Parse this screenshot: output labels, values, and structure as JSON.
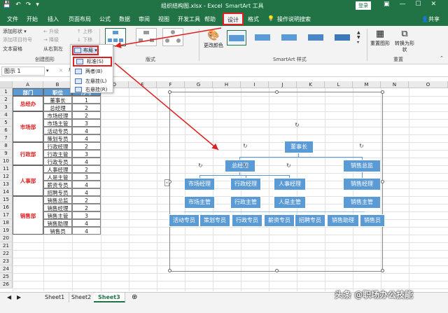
{
  "titlebar": {
    "file_title": "组织结构图.xlsx - Excel",
    "context_title": "SmartArt 工具",
    "login": "登录",
    "min": "—",
    "restore": "☐",
    "close": "✕"
  },
  "tabs": [
    "文件",
    "开始",
    "插入",
    "页面布局",
    "公式",
    "数据",
    "审阅",
    "视图",
    "开发工具",
    "帮助"
  ],
  "tab_design": "设计",
  "tab_format": "格式",
  "tell_me": "操作说明搜索",
  "share": "共享",
  "ribbon": {
    "add_shape": "添加形状 ▾",
    "add_bullet": "添加项目符号",
    "text_pane": "文本窗格",
    "promote": "← 升级",
    "demote": "→ 降级",
    "rtl": "从右到左",
    "move_up": "↑ 上移",
    "move_down": "↓ 下移",
    "layout_btn": "布局 ▾",
    "group_create": "创建图形",
    "group_layouts": "版式",
    "change_colors": "更改颜色",
    "group_styles": "SmartArt 样式",
    "reset": "重置图形",
    "convert": "转换为形状",
    "group_reset": "重置"
  },
  "layout_menu": {
    "standard": "标准(S)",
    "both": "两者(B)",
    "left_hanging": "左悬挂(L)",
    "right_hanging": "右悬挂(R)"
  },
  "formula_bar": {
    "name_box": "图示 1",
    "fx": "fx",
    "cancel": "✕"
  },
  "columns": [
    "A",
    "B",
    "C",
    "D",
    "E",
    "F",
    "G",
    "H",
    "I",
    "J",
    "K",
    "L",
    "M",
    "N",
    "O"
  ],
  "rows": [
    "1",
    "2",
    "3",
    "4",
    "5",
    "6",
    "7",
    "8",
    "9",
    "10",
    "11",
    "12",
    "13",
    "14",
    "15",
    "16",
    "17",
    "18",
    "19",
    "20",
    "21",
    "22",
    "23",
    "24",
    "25",
    "26"
  ],
  "table": {
    "headers": [
      "部门",
      "职位",
      "序号"
    ],
    "depts": [
      "总经办",
      "市场部",
      "行政部",
      "人事部",
      "销售部"
    ],
    "positions": [
      "董事长",
      "总经理",
      "市场经理",
      "市场主管",
      "活动专员",
      "策划专员",
      "行政经理",
      "行政主管",
      "行政专员",
      "人事经理",
      "人是主管",
      "薪资专员",
      "招聘专员",
      "销售总监",
      "销售经理",
      "销售主管",
      "销售助理",
      "销售员"
    ],
    "levels": [
      "1",
      "2",
      "2",
      "3",
      "4",
      "4",
      "2",
      "3",
      "4",
      "2",
      "3",
      "4",
      "4",
      "2",
      "2",
      "3",
      "4",
      "4"
    ]
  },
  "smartart": {
    "top": "董事长",
    "l2": [
      "总经理",
      "销售总监"
    ],
    "l3": [
      "市场经理",
      "行政经理",
      "人事经理",
      "销售经理"
    ],
    "l4": [
      "市场主管",
      "行政主管",
      "人是主管",
      "销售主管"
    ],
    "l5": [
      "活动专员",
      "策划专员",
      "行政专员",
      "薪资专员",
      "招聘专员",
      "销售助理",
      "销售员"
    ]
  },
  "sheets": [
    "Sheet1",
    "Sheet2",
    "Sheet3"
  ],
  "active_sheet": "Sheet3",
  "add_sheet": "⊕",
  "watermark": "头条 @职场办公技能",
  "colors": {
    "excel_green": "#217346",
    "node_blue": "#5b9bd5",
    "highlight_red": "#e02020"
  }
}
